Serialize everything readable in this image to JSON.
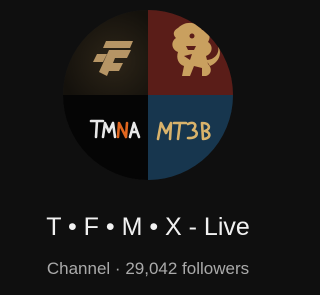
{
  "channel": {
    "name": "T • F • M • X - Live",
    "type_label": "Channel",
    "separator": "·",
    "subscribers": "29,042 followers",
    "avatar": {
      "quadrants": [
        {
          "icon": "tf-logo-icon",
          "background": "#14110c"
        },
        {
          "icon": "lion-crest-icon",
          "background": "#5a1d18"
        },
        {
          "icon": "tmna-logo-icon",
          "text": "TMNA",
          "background": "#050505"
        },
        {
          "icon": "mt3b-logo-icon",
          "text": "MT3B",
          "background": "#17364e"
        }
      ]
    }
  },
  "colors": {
    "background": "#0f0f0f",
    "title": "#f1f1f1",
    "meta": "#aaaaaa"
  }
}
